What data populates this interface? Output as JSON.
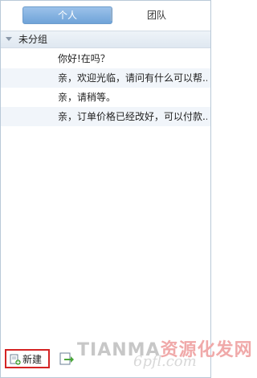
{
  "tabs": [
    {
      "label": "个人",
      "active": true
    },
    {
      "label": "团队",
      "active": false
    }
  ],
  "group": {
    "title": "未分组"
  },
  "replies": [
    "你好!在吗？",
    "亲，欢迎光临，请问有什么可以帮...",
    "亲，请稍等。",
    "亲，订单价格已经改好，可以付款..."
  ],
  "toolbar": {
    "new_label": "新建"
  },
  "watermark": {
    "line1_gray": "TIANMA",
    "line1_mark": "资源化发网",
    "line2": "6pfl.com"
  },
  "colors": {
    "accent": "#6fa3d8",
    "highlight_border": "#d42424"
  }
}
